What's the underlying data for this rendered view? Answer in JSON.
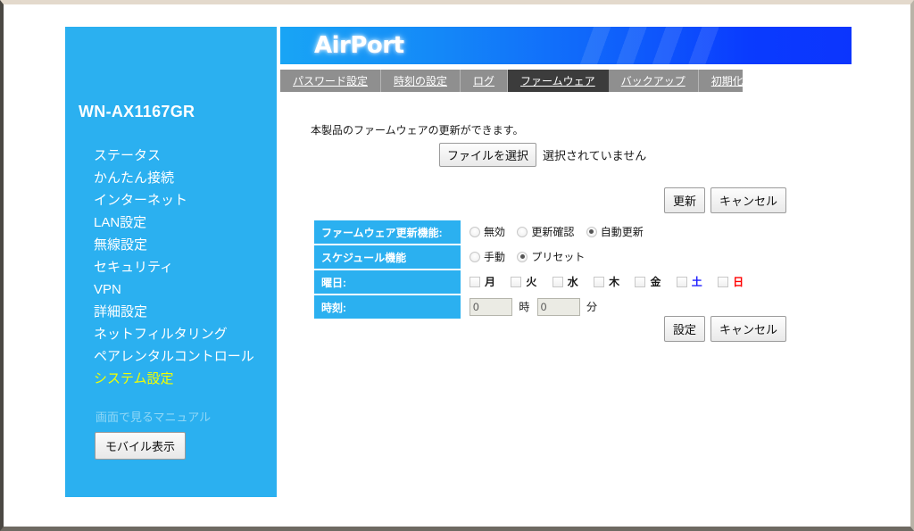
{
  "banner": {
    "logo_text": "AirPort"
  },
  "sidebar": {
    "device_name": "WN-AX1167GR",
    "items": [
      {
        "label": "ステータス",
        "active": false
      },
      {
        "label": "かんたん接続",
        "active": false
      },
      {
        "label": "インターネット",
        "active": false
      },
      {
        "label": "LAN設定",
        "active": false
      },
      {
        "label": "無線設定",
        "active": false
      },
      {
        "label": "セキュリティ",
        "active": false
      },
      {
        "label": "VPN",
        "active": false
      },
      {
        "label": "詳細設定",
        "active": false
      },
      {
        "label": "ネットフィルタリング",
        "active": false
      },
      {
        "label": "ペアレンタルコントロール",
        "active": false
      },
      {
        "label": "システム設定",
        "active": true
      }
    ],
    "manual_link": "画面で見るマニュアル",
    "mobile_button": "モバイル表示"
  },
  "tabs": [
    {
      "label": "パスワード設定",
      "active": false
    },
    {
      "label": "時刻の設定",
      "active": false
    },
    {
      "label": "ログ",
      "active": false
    },
    {
      "label": "ファームウェア",
      "active": true
    },
    {
      "label": "バックアップ",
      "active": false
    },
    {
      "label": "初期化",
      "active": false
    }
  ],
  "main": {
    "intro_text": "本製品のファームウェアの更新ができます。",
    "file_select_button": "ファイルを選択",
    "file_status_text": "選択されていません",
    "update_button": "更新",
    "update_cancel_button": "キャンセル",
    "apply_button": "設定",
    "apply_cancel_button": "キャンセル"
  },
  "settings": {
    "rows": [
      {
        "label": "ファームウェア更新機能:",
        "type": "radio",
        "options": [
          {
            "label": "無効",
            "checked": false
          },
          {
            "label": "更新確認",
            "checked": false
          },
          {
            "label": "自動更新",
            "checked": true
          }
        ]
      },
      {
        "label": "スケジュール機能",
        "type": "radio",
        "options": [
          {
            "label": "手動",
            "checked": false
          },
          {
            "label": "プリセット",
            "checked": true
          }
        ]
      },
      {
        "label": "曜日:",
        "type": "checkbox",
        "options": [
          {
            "label": "月",
            "checked": false,
            "color": "default"
          },
          {
            "label": "火",
            "checked": false,
            "color": "default"
          },
          {
            "label": "水",
            "checked": false,
            "color": "default"
          },
          {
            "label": "木",
            "checked": false,
            "color": "default"
          },
          {
            "label": "金",
            "checked": false,
            "color": "default"
          },
          {
            "label": "土",
            "checked": false,
            "color": "blue"
          },
          {
            "label": "日",
            "checked": false,
            "color": "red"
          }
        ]
      },
      {
        "label": "時刻:",
        "type": "time",
        "hour_value": "0",
        "hour_unit": "時",
        "minute_value": "0",
        "minute_unit": "分"
      }
    ]
  },
  "colors": {
    "brand_blue": "#2BB0F0",
    "banner_blue_left": "#18A5F5",
    "banner_blue_right": "#0C35FD",
    "active_nav_yellow": "#F2FF00",
    "tabbar_gray": "#8F8F8F",
    "active_tab_gray": "#3C3C3C",
    "saturday_blue": "#2020FF",
    "sunday_red": "#FF0000"
  }
}
